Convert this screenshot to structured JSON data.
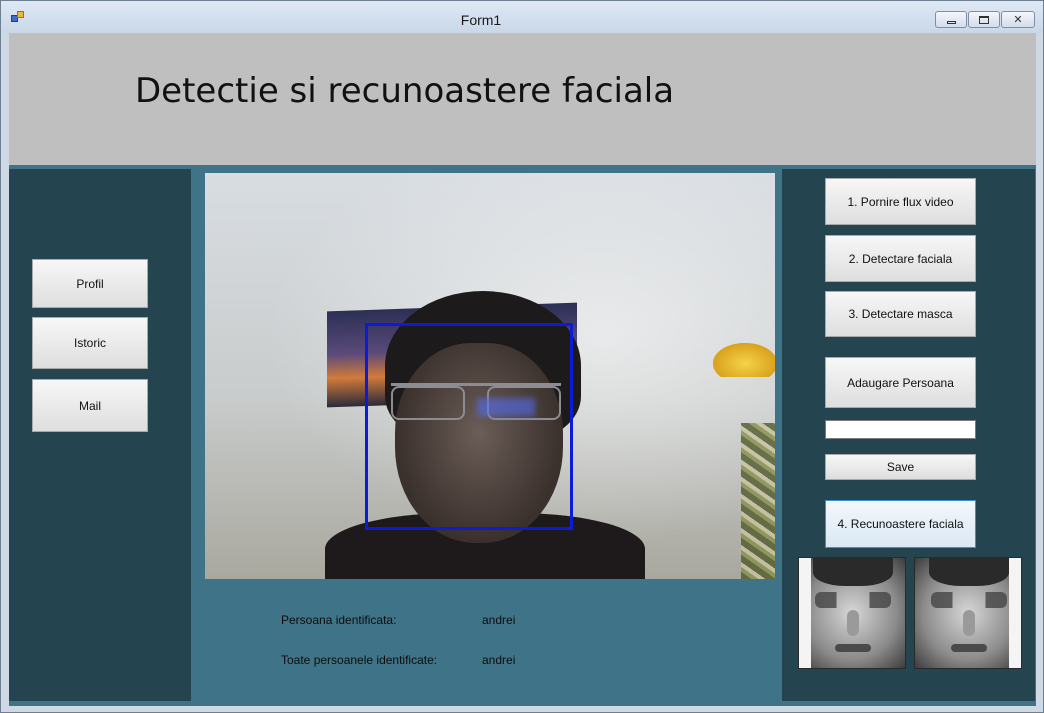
{
  "window": {
    "title": "Form1",
    "icon": "winforms-app-icon",
    "controls": [
      "minimize-icon",
      "maximize-icon",
      "close-icon"
    ]
  },
  "header": {
    "title": "Detectie si recunoastere faciala"
  },
  "left_nav": {
    "profile_label": "Profil",
    "history_label": "Istoric",
    "mail_label": "Mail"
  },
  "right_actions": {
    "start_video_label": "1. Pornire flux video",
    "face_detect_label": "2. Detectare faciala",
    "mask_detect_label": "3. Detectare masca",
    "add_person_label": "Adaugare Persoana",
    "person_name_value": "",
    "save_label": "Save",
    "recognition_label": "4. Recunoastere faciala"
  },
  "results": {
    "identified_label": "Persoana identificata:",
    "identified_value": "andrei",
    "all_identified_label": "Toate persoanele identificate:",
    "all_identified_value": "andrei"
  },
  "colors": {
    "header_bg": "#bfbfbf",
    "client_bg": "#3f7387",
    "side_panel_bg": "#24444f",
    "face_box": "#0b1bd8"
  }
}
